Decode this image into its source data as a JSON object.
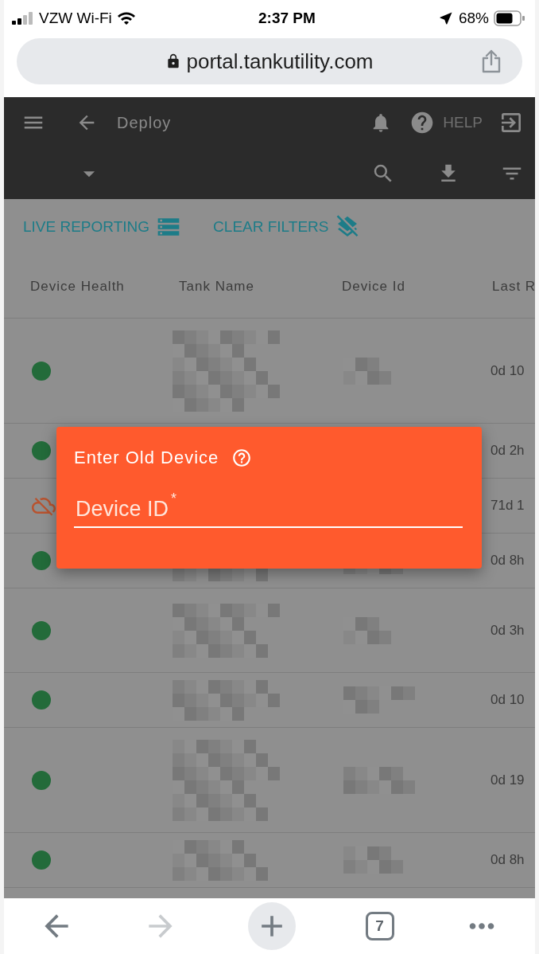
{
  "status_bar": {
    "carrier": "VZW Wi-Fi",
    "time": "2:37 PM",
    "battery": "68%"
  },
  "address_bar": {
    "url": "portal.tankutility.com"
  },
  "header": {
    "title": "Deploy",
    "help_label": "HELP"
  },
  "filter_links": [
    {
      "label": "LIVE REPORTING",
      "kind": "live"
    },
    {
      "label": "CLEAR FILTERS",
      "kind": "clear"
    }
  ],
  "table": {
    "columns": [
      "Device Health",
      "Tank Name",
      "Device Id",
      "Last R"
    ],
    "rows": [
      {
        "kind": "online",
        "last": "0d 10"
      },
      {
        "kind": "online",
        "last": "0d 2h"
      },
      {
        "kind": "offline",
        "last": "71d 1"
      },
      {
        "kind": "online",
        "last": "0d 8h"
      },
      {
        "kind": "online",
        "last": "0d 3h"
      },
      {
        "kind": "online",
        "last": "0d 10"
      },
      {
        "kind": "online",
        "last": "0d 19"
      },
      {
        "kind": "online",
        "last": "0d 8h"
      }
    ]
  },
  "dialog": {
    "title": "Enter Old Device",
    "field": {
      "placeholder": "Device ID",
      "required_mark": "*"
    }
  },
  "browser_toolbar": {
    "forward_disabled": true,
    "tab_count": "7"
  }
}
